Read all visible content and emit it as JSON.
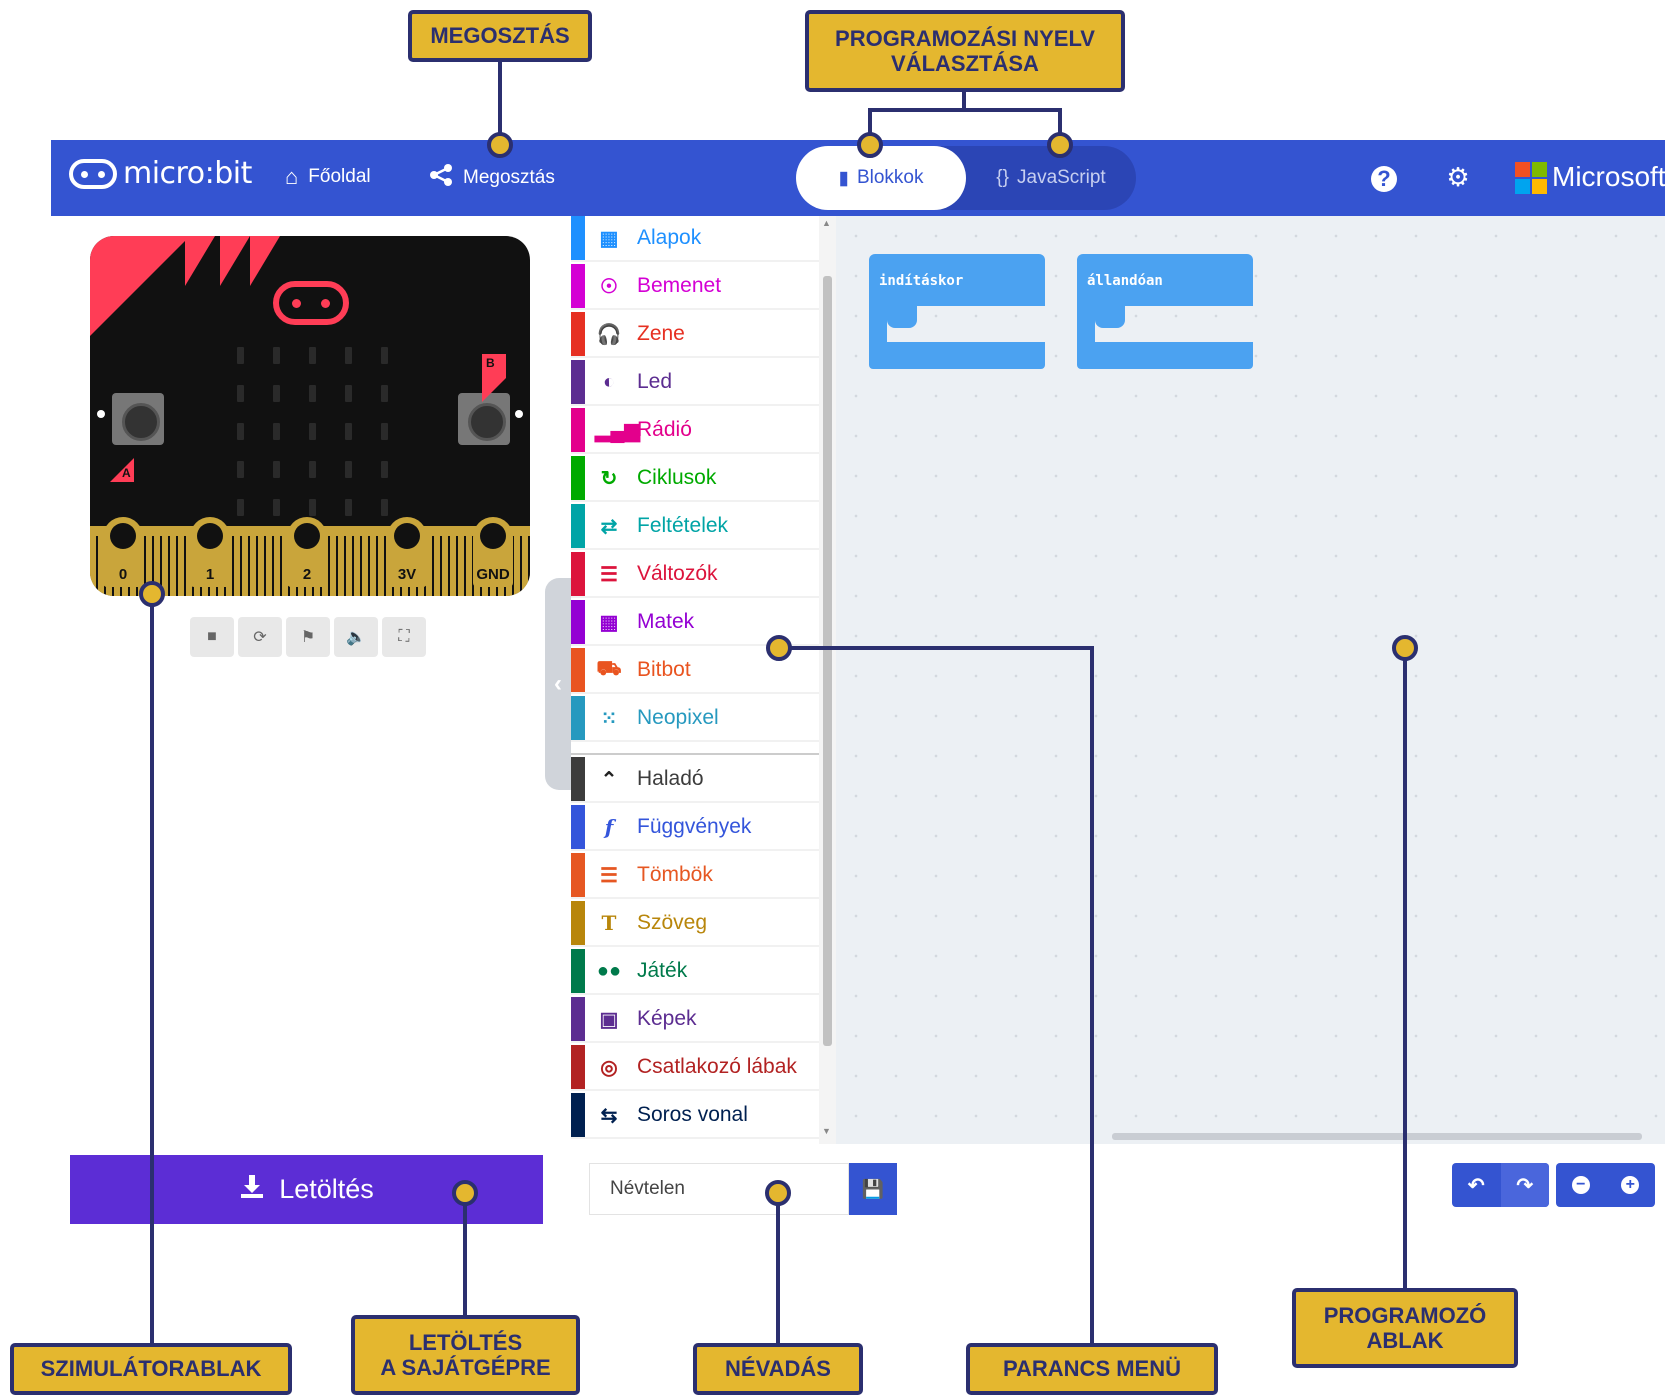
{
  "header": {
    "logo_text": "micro:bit",
    "home_label": "Főoldal",
    "share_label": "Megosztás",
    "lang_blocks_label": "Blokkok",
    "lang_js_label": "JavaScript",
    "brand_label": "Microsoft",
    "background_color": "#3454d1"
  },
  "simulator": {
    "button_a_label": "A",
    "button_b_label": "B",
    "pins": [
      "0",
      "1",
      "2",
      "3V",
      "GND"
    ],
    "controls": [
      "stop-icon",
      "restart-icon",
      "debug-icon",
      "mute-icon",
      "fullscreen-icon"
    ]
  },
  "download": {
    "label": "Letöltés"
  },
  "toolbox": {
    "categories": [
      {
        "label": "Alapok",
        "color": "#1e90ff",
        "icon": "grid-icon"
      },
      {
        "label": "Bemenet",
        "color": "#d400d4",
        "icon": "target-icon"
      },
      {
        "label": "Zene",
        "color": "#e63022",
        "icon": "headphones-icon"
      },
      {
        "label": "Led",
        "color": "#5c2d91",
        "icon": "toggle-icon"
      },
      {
        "label": "Rádió",
        "color": "#e3008c",
        "icon": "signal-icon"
      },
      {
        "label": "Ciklusok",
        "color": "#00aa00",
        "icon": "loop-icon"
      },
      {
        "label": "Feltételek",
        "color": "#00a4a6",
        "icon": "shuffle-icon"
      },
      {
        "label": "Változók",
        "color": "#dc143c",
        "icon": "lines-icon"
      },
      {
        "label": "Matek",
        "color": "#9400d3",
        "icon": "calculator-icon"
      },
      {
        "label": "Bitbot",
        "color": "#e95420",
        "icon": "car-icon"
      },
      {
        "label": "Neopixel",
        "color": "#2699bf",
        "icon": "sparkle-icon"
      }
    ],
    "advanced": [
      {
        "label": "Haladó",
        "color": "#3c3c3c",
        "icon": "chevron-up-icon"
      },
      {
        "label": "Függvények",
        "color": "#3455db",
        "icon": "function-icon"
      },
      {
        "label": "Tömbök",
        "color": "#e65722",
        "icon": "list-icon"
      },
      {
        "label": "Szöveg",
        "color": "#b8860b",
        "icon": "text-icon"
      },
      {
        "label": "Játék",
        "color": "#007a4b",
        "icon": "gamepad-icon"
      },
      {
        "label": "Képek",
        "color": "#5c2d91",
        "icon": "image-icon"
      },
      {
        "label": "Csatlakozó lábak",
        "color": "#b22222",
        "icon": "pin-icon"
      },
      {
        "label": "Soros vonal",
        "color": "#002050",
        "icon": "usb-icon"
      }
    ]
  },
  "workspace": {
    "blocks": [
      {
        "label": "indításkor"
      },
      {
        "label": "állandóan"
      }
    ]
  },
  "bottom": {
    "project_name": "Névtelen"
  },
  "callouts": {
    "share": "MEGOSZTÁS",
    "language": "PROGRAMOZÁSI NYELV\nVÁLASZTÁSA",
    "simulator": "SZIMULÁTORABLAK",
    "download": "LETÖLTÉS\nA SAJÁTGÉPRE",
    "naming": "NÉVADÁS",
    "command_menu": "PARANCS MENÜ",
    "program_window": "PROGRAMOZÓ\nABLAK"
  }
}
